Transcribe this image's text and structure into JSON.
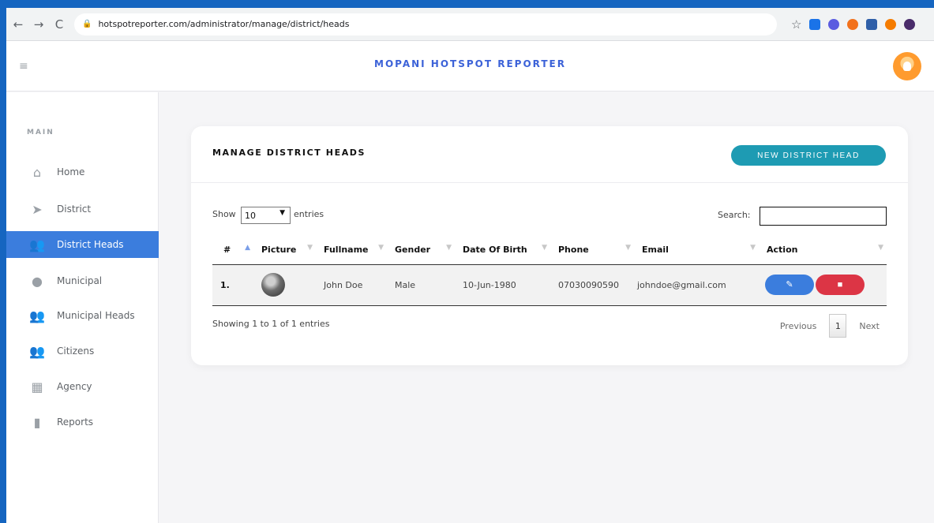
{
  "browser": {
    "url": "hotspotreporter.com/administrator/manage/district/heads",
    "back_icon": "←",
    "forward_icon": "→",
    "reload_icon": "C",
    "star_icon": "☆"
  },
  "header": {
    "title": "MOPANI HOTSPOT REPORTER",
    "hamburger_icon": "≡"
  },
  "sidebar": {
    "section": "MAIN",
    "items": [
      {
        "label": "Home",
        "icon": "home-icon",
        "glyph": "⌂"
      },
      {
        "label": "District",
        "icon": "location-arrow-icon",
        "glyph": "➤"
      },
      {
        "label": "District Heads",
        "icon": "users-icon",
        "glyph": "👥",
        "active": true
      },
      {
        "label": "Municipal",
        "icon": "map-marker-icon",
        "glyph": "●"
      },
      {
        "label": "Municipal Heads",
        "icon": "users-icon",
        "glyph": "👥"
      },
      {
        "label": "Citizens",
        "icon": "users-icon",
        "glyph": "👥"
      },
      {
        "label": "Agency",
        "icon": "building-icon",
        "glyph": "▦"
      },
      {
        "label": "Reports",
        "icon": "file-icon",
        "glyph": "▮"
      }
    ]
  },
  "card": {
    "title": "MANAGE DISTRICT HEADS",
    "new_button": "NEW DISTRICT HEAD"
  },
  "controls": {
    "show": "Show",
    "entries_value": "10",
    "entries": "entries",
    "search": "Search:"
  },
  "table": {
    "headers": [
      "#",
      "Picture",
      "Fullname",
      "Gender",
      "Date Of Birth",
      "Phone",
      "Email",
      "Action"
    ],
    "rows": [
      {
        "num": "1.",
        "fullname": "John Doe",
        "gender": "Male",
        "dob": "10-Jun-1980",
        "phone": "07030090590",
        "email": "johndoe@gmail.com"
      }
    ]
  },
  "footer": {
    "info": "Showing 1 to 1 of 1 entries",
    "previous": "Previous",
    "page": "1",
    "next": "Next"
  },
  "colors": {
    "accent": "#3b7ddd",
    "teal": "#1e9bb3",
    "danger": "#dc3545",
    "frame": "#1565c0"
  }
}
